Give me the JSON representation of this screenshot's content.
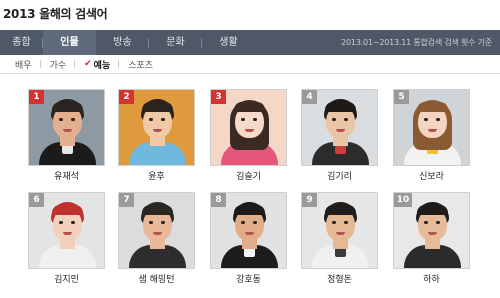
{
  "page": {
    "title": "2013 올해의 검색어"
  },
  "tabs": [
    {
      "label": "종합",
      "active": false
    },
    {
      "label": "인물",
      "active": true
    },
    {
      "label": "방송",
      "active": false
    },
    {
      "label": "문화",
      "active": false
    },
    {
      "label": "생활",
      "active": false
    }
  ],
  "tab_info": "2013.01~2013.11 통합검색 검색 횟수 기준",
  "subtabs": [
    {
      "label": "배우",
      "active": false
    },
    {
      "label": "가수",
      "active": false
    },
    {
      "label": "예능",
      "active": true,
      "checkmark": "✔"
    },
    {
      "label": "스포츠",
      "active": false
    }
  ],
  "people": [
    {
      "rank": "1",
      "name": "유재석",
      "bg": "#8e9aa3",
      "skin": "#e3b08f",
      "hair": "#2a2420",
      "shirt": "#1b1b1b",
      "tie": "#e8e8e8"
    },
    {
      "rank": "2",
      "name": "윤후",
      "bg": "#e09a3e",
      "skin": "#f0c9a6",
      "hair": "#2b231d",
      "shirt": "#6fb8de",
      "tie": "#6fb8de"
    },
    {
      "rank": "3",
      "name": "김슬기",
      "bg": "#f4d7c7",
      "skin": "#f6d9c6",
      "hair": "#3a2a22",
      "shirt": "#e4567a",
      "tie": "#e4567a"
    },
    {
      "rank": "4",
      "name": "김기리",
      "bg": "#d9dde0",
      "skin": "#e9c5a6",
      "hair": "#1e1a18",
      "shirt": "#2c2c2c",
      "tie": "#d13c3c"
    },
    {
      "rank": "5",
      "name": "신보라",
      "bg": "#cfd4d8",
      "skin": "#f2d4c0",
      "hair": "#8a5a33",
      "shirt": "#f2f2f2",
      "tie": "#f0c12b"
    },
    {
      "rank": "6",
      "name": "김지민",
      "bg": "#e4e4e4",
      "skin": "#f2d0bb",
      "hair": "#c0322d",
      "shirt": "#efefef",
      "tie": "#efefef"
    },
    {
      "rank": "7",
      "name": "샘 해밍턴",
      "bg": "#dcdcdc",
      "skin": "#e8b899",
      "hair": "#2a2622",
      "shirt": "#2d2d2d",
      "tie": "#2d2d2d"
    },
    {
      "rank": "8",
      "name": "강호동",
      "bg": "#e2e2e2",
      "skin": "#e2ad89",
      "hair": "#1d1b1a",
      "shirt": "#1d1d1d",
      "tie": "#f3f3f3"
    },
    {
      "rank": "9",
      "name": "정형돈",
      "bg": "#e6e6e6",
      "skin": "#e6b995",
      "hair": "#1f1c1a",
      "shirt": "#f0f0f0",
      "tie": "#3a3a3a"
    },
    {
      "rank": "10",
      "name": "하하",
      "bg": "#e8e8e8",
      "skin": "#e5bb9a",
      "hair": "#1f1c1a",
      "shirt": "#2b2b2b",
      "tie": "#2b2b2b"
    }
  ]
}
